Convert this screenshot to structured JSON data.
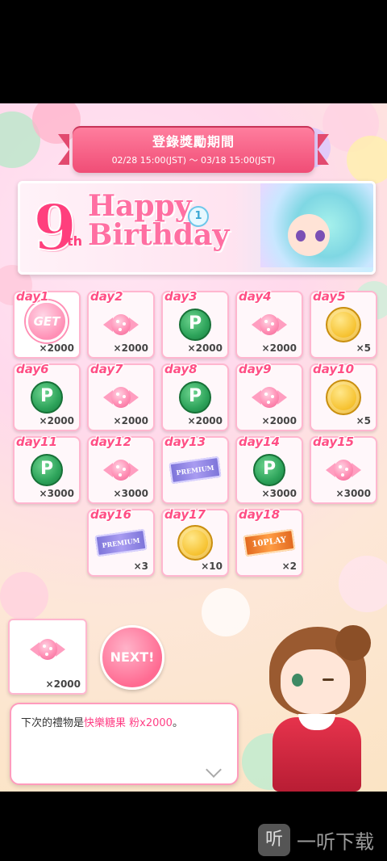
{
  "header": {
    "title": "登錄獎勵期間",
    "period": "02/28 15:00(JST) ～ 03/18 15:00(JST)"
  },
  "banner": {
    "number": "9",
    "suffix": "th",
    "line1": "Happy",
    "line2": "Birthday",
    "badge": "1"
  },
  "days": [
    {
      "label": "day1",
      "item": "candy",
      "qty": "×2000",
      "claimed": true,
      "claim_label": "GET"
    },
    {
      "label": "day2",
      "item": "candy",
      "qty": "×2000"
    },
    {
      "label": "day3",
      "item": "pcoin",
      "qty": "×2000"
    },
    {
      "label": "day4",
      "item": "candy",
      "qty": "×2000"
    },
    {
      "label": "day5",
      "item": "gold",
      "qty": "×5"
    },
    {
      "label": "day6",
      "item": "pcoin",
      "qty": "×2000"
    },
    {
      "label": "day7",
      "item": "candy",
      "qty": "×2000"
    },
    {
      "label": "day8",
      "item": "pcoin",
      "qty": "×2000"
    },
    {
      "label": "day9",
      "item": "candy",
      "qty": "×2000"
    },
    {
      "label": "day10",
      "item": "gold",
      "qty": "×5"
    },
    {
      "label": "day11",
      "item": "pcoin",
      "qty": "×3000"
    },
    {
      "label": "day12",
      "item": "candy",
      "qty": "×3000"
    },
    {
      "label": "day13",
      "item": "premium",
      "qty": "",
      "ticket_text": "PREMIUM"
    },
    {
      "label": "day14",
      "item": "pcoin",
      "qty": "×3000"
    },
    {
      "label": "day15",
      "item": "candy",
      "qty": "×3000"
    },
    {
      "label": "day16",
      "item": "premium",
      "qty": "×3",
      "ticket_text": "PREMIUM"
    },
    {
      "label": "day17",
      "item": "gold",
      "qty": "×10"
    },
    {
      "label": "day18",
      "item": "ten",
      "qty": "×2",
      "ticket_text": "10PLAY"
    }
  ],
  "pcoin_letter": "P",
  "next_reward": {
    "item": "candy",
    "qty": "×2000",
    "button_label": "NEXT!"
  },
  "dialog": {
    "prefix": "下次的禮物是",
    "item_name": "快樂糖果 粉x2000",
    "suffix": "。"
  },
  "watermark": {
    "glyph": "听",
    "text": "一听下载"
  },
  "colors": {
    "accent": "#ff4f85",
    "ribbon": "#f04d76",
    "p_coin": "#2da35a",
    "gold_coin": "#f6c230"
  }
}
